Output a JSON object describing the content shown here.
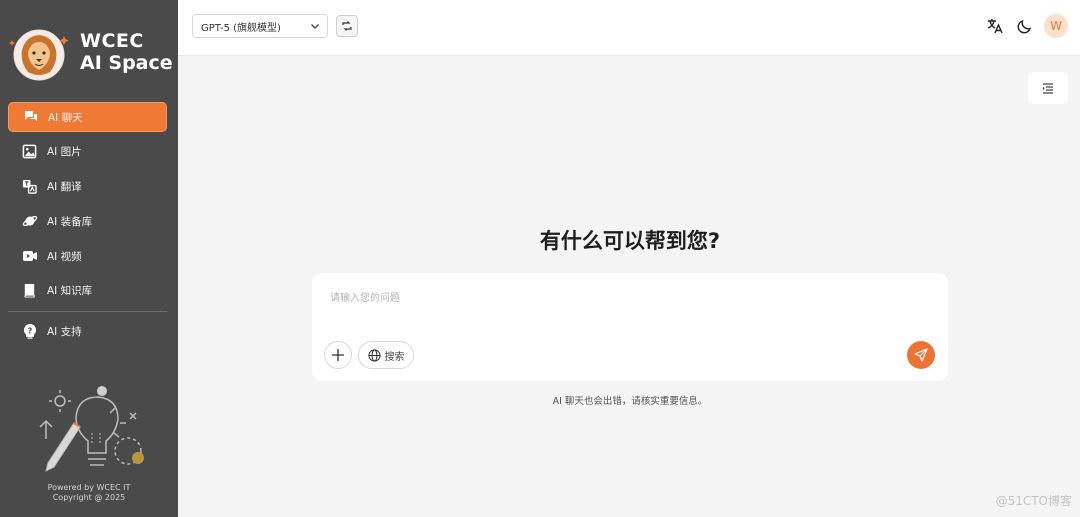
{
  "brand": {
    "line1": "WCEC",
    "line2": "AI Space",
    "accent": "#f07a35"
  },
  "sidebar": {
    "items": [
      {
        "label": "AI 聊天",
        "icon": "chat-icon",
        "active": true
      },
      {
        "label": "AI 图片",
        "icon": "image-icon",
        "active": false
      },
      {
        "label": "AI 翻译",
        "icon": "translate-icon",
        "active": false
      },
      {
        "label": "AI 装备库",
        "icon": "planet-icon",
        "active": false
      },
      {
        "label": "AI 视频",
        "icon": "video-icon",
        "active": false
      },
      {
        "label": "AI 知识库",
        "icon": "book-icon",
        "active": false
      }
    ],
    "support": {
      "label": "AI 支持",
      "icon": "help-icon"
    },
    "powered_line1": "Powered by WCEC IT",
    "powered_line2": "Copyright @ 2025"
  },
  "topbar": {
    "model": "GPT-5 (旗舰模型)",
    "icons": [
      "language-icon",
      "moon-icon"
    ],
    "avatar_letter": "W"
  },
  "main": {
    "greeting": "有什么可以帮到您?",
    "input_placeholder": "请输入您的问题",
    "search_label": "搜索",
    "disclaimer": "AI 聊天也会出错，请核实重要信息。"
  },
  "watermark": "@51CTO博客"
}
